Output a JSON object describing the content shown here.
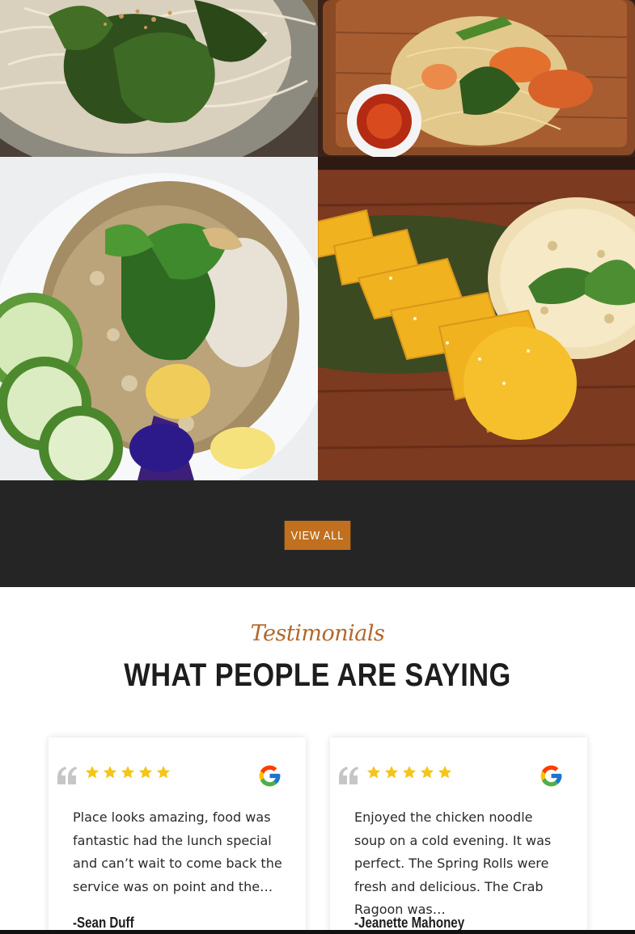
{
  "gallery": {
    "images": [
      {
        "name": "noodle-salad-photo"
      },
      {
        "name": "grilled-shrimp-noodles-photo"
      },
      {
        "name": "fried-rice-photo"
      },
      {
        "name": "mango-sticky-rice-photo"
      }
    ]
  },
  "cta": {
    "view_all_label": "VIEW ALL"
  },
  "testimonials": {
    "eyebrow": "Testimonials",
    "heading": "WHAT PEOPLE ARE SAYING",
    "reviews": [
      {
        "rating": 5,
        "source_icon": "google-icon",
        "text": "Place looks amazing, food was fantastic had the lunch special and can’t wait to come back the service was on point and the…",
        "author": "-Sean Duff"
      },
      {
        "rating": 5,
        "source_icon": "google-icon",
        "text": "Enjoyed the chicken noodle soup on a cold evening. It was perfect. The Spring Rolls were fresh and delicious. The Crab Ragoon was…",
        "author": "-Jeanette Mahoney"
      }
    ]
  },
  "colors": {
    "accent": "#c0701f",
    "eyebrow": "#b3672b",
    "band": "#252525",
    "star": "#f5c518"
  }
}
